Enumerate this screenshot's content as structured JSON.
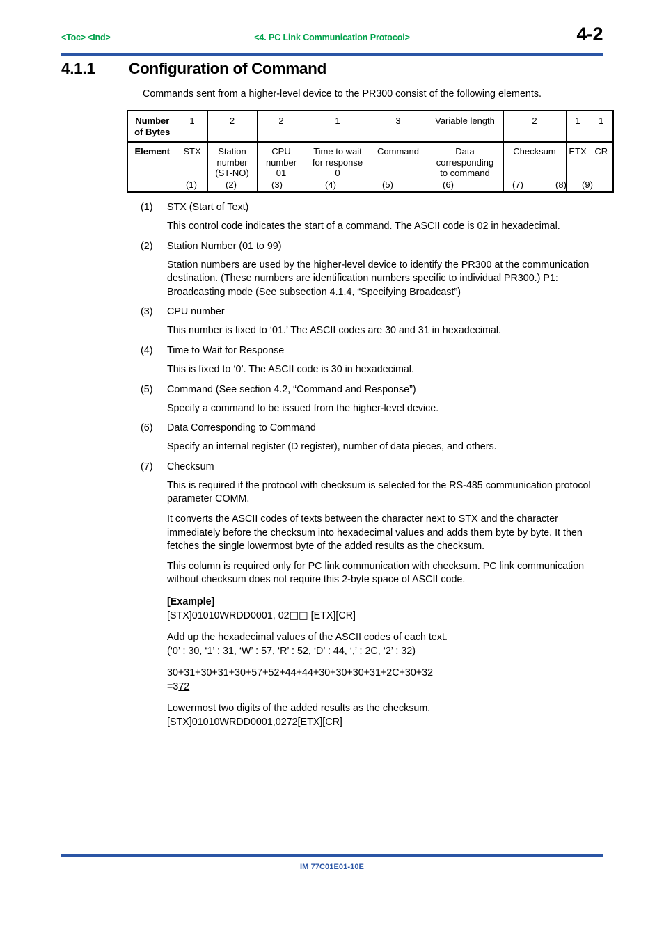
{
  "header": {
    "toc_link": "<Toc> <Ind>",
    "center_title": "<4.  PC Link Communication Protocol>",
    "page_number": "4-2"
  },
  "section": {
    "number": "4.1.1",
    "title": "Configuration of Command"
  },
  "intro": "Commands sent from a higher-level device to the PR300 consist of the following elements.",
  "table": {
    "row_labels": [
      "Number\nof Bytes",
      "Element"
    ],
    "bytes_label_line1": "Number",
    "bytes_label_line2": "of Bytes",
    "element_label": "Element",
    "bytes": [
      "1",
      "2",
      "2",
      "1",
      "3",
      "Variable length",
      "2",
      "1",
      "1"
    ],
    "elements": [
      "STX",
      "Station\nnumber\n(ST-NO)",
      "CPU\nnumber\n01",
      "Time to wait\nfor response\n0",
      "Command",
      "Data\ncorresponding\nto command",
      "Checksum",
      "ETX",
      "CR"
    ],
    "elements_lines": [
      [
        "STX"
      ],
      [
        "Station",
        "number",
        "(ST-NO)"
      ],
      [
        "CPU",
        "number",
        "01"
      ],
      [
        "Time to wait",
        "for response",
        "0"
      ],
      [
        "Command"
      ],
      [
        "Data",
        "corresponding",
        "to command"
      ],
      [
        "Checksum"
      ],
      [
        "ETX"
      ],
      [
        "CR"
      ]
    ],
    "column_numbers": [
      "(1)",
      "(2)",
      "(3)",
      "(4)",
      "(5)",
      "(6)",
      "(7)",
      "(8)",
      "(9)"
    ]
  },
  "items": [
    {
      "marker": "(1)",
      "title": "STX (Start of Text)",
      "paragraphs": [
        "This control code indicates the start of a command.  The ASCII code is 02 in hexadecimal."
      ]
    },
    {
      "marker": "(2)",
      "title": "Station Number (01 to 99)",
      "paragraphs": [
        "Station numbers are used by the higher-level device to identify the PR300 at the communication destination. (These numbers are identification numbers specific to individual PR300.) P1: Broadcasting mode (See subsection 4.1.4, “Specifying Broadcast”)"
      ]
    },
    {
      "marker": "(3)",
      "title": "CPU number",
      "paragraphs": [
        "This number is fixed to ‘01.’ The ASCII codes are 30 and 31 in hexadecimal."
      ]
    },
    {
      "marker": "(4)",
      "title": "Time to Wait for Response",
      "paragraphs": [
        "This is fixed to ‘0’. The ASCII code is 30 in hexadecimal."
      ]
    },
    {
      "marker": "(5)",
      "title": "Command (See section 4.2, “Command and Response”)",
      "paragraphs": [
        "Specify a command to be issued from the higher-level device."
      ]
    },
    {
      "marker": "(6)",
      "title": "Data Corresponding to Command",
      "paragraphs": [
        "Specify an internal register (D register), number of data pieces, and others."
      ]
    },
    {
      "marker": "(7)",
      "title": "Checksum",
      "paragraphs": [
        "This is required if the protocol with checksum is selected for the RS-485 communication protocol parameter COMM.",
        "It converts the ASCII codes of texts between the character next to STX and the character immediately before the checksum into hexadecimal values and adds them byte by byte.  It then fetches the single lowermost byte of the added results as the checksum.",
        "This column is required only for PC link communication with checksum.  PC link communication without checksum does not require this 2-byte space of ASCII code."
      ]
    }
  ],
  "example": {
    "title": "[Example]",
    "command_line_prefix": "[STX]01010WRDD0001, 02",
    "command_line_squares": "□□",
    "command_line_suffix": " [ETX][CR]",
    "add_up_line": "Add up the hexadecimal values of the ASCII codes of each text.",
    "codes_line": "(‘0’ : 30, ‘1’ : 31, ‘W’ : 57, ‘R’ : 52, ‘D’ : 44, ‘,’ : 2C, ‘2’ : 32)",
    "sum_line": "30+31+30+31+30+57+52+44+44+30+30+30+31+2C+30+32",
    "result_prefix": "=3",
    "result_underlined": "72",
    "lowermost_line": "Lowermost two digits of the added results as the checksum.",
    "final_line": "[STX]01010WRDD0001,0272[ETX][CR]"
  },
  "footer": {
    "doc_code": "IM 77C01E01-10E"
  },
  "colors": {
    "header_green": "#00a14b",
    "rule_blue": "#2a55a5",
    "text_black": "#000000"
  }
}
